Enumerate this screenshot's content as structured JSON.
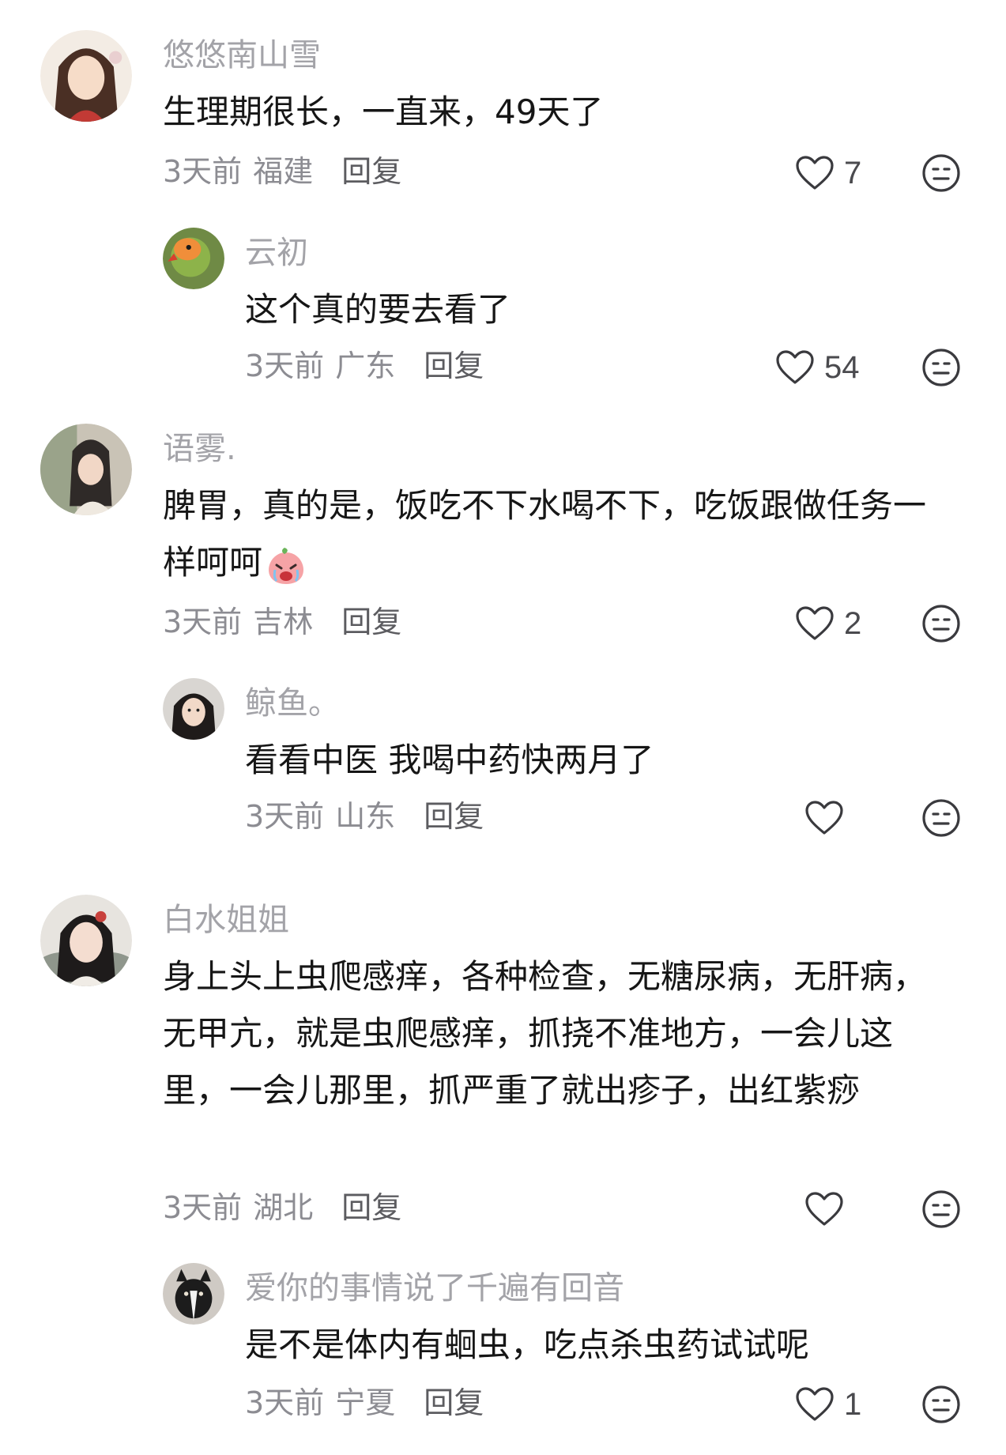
{
  "comments": [
    {
      "username": "悠悠南山雪",
      "content": "生理期很长，一直来，49天了",
      "time": "3天前",
      "region": "福建",
      "reply_label": "回复",
      "likes": "7"
    },
    {
      "username": "云初",
      "content": "这个真的要去看了",
      "time": "3天前",
      "region": "广东",
      "reply_label": "回复",
      "likes": "54"
    },
    {
      "username": "语雾.",
      "content": "脾胃，真的是，饭吃不下水喝不下，吃饭跟做任务一样呵呵",
      "time": "3天前",
      "region": "吉林",
      "reply_label": "回复",
      "likes": "2"
    },
    {
      "username": "鲸鱼。",
      "content": "看看中医 我喝中药快两月了",
      "time": "3天前",
      "region": "山东",
      "reply_label": "回复",
      "likes": ""
    },
    {
      "username": "白水姐姐",
      "content": "身上头上虫爬感痒，各种检查，无糖尿病，无肝病，无甲亢，就是虫爬感痒，抓挠不准地方，一会儿这里，一会儿那里，抓严重了就出疹子，出红紫痧",
      "time": "3天前",
      "region": "湖北",
      "reply_label": "回复",
      "likes": ""
    },
    {
      "username": "爱你的事情说了千遍有回音",
      "content": "是不是体内有蛔虫，吃点杀虫药试试呢",
      "time": "3天前",
      "region": "宁夏",
      "reply_label": "回复",
      "likes": "1"
    }
  ],
  "icons": {
    "like": "heart-outline-icon",
    "dislike": "meh-face-icon",
    "inline_emoji": "crying-peach-emoji"
  },
  "colors": {
    "username": "#a3a3a8",
    "content": "#161616",
    "meta": "#8c8c92",
    "icon_stroke": "#3a3a3e"
  }
}
